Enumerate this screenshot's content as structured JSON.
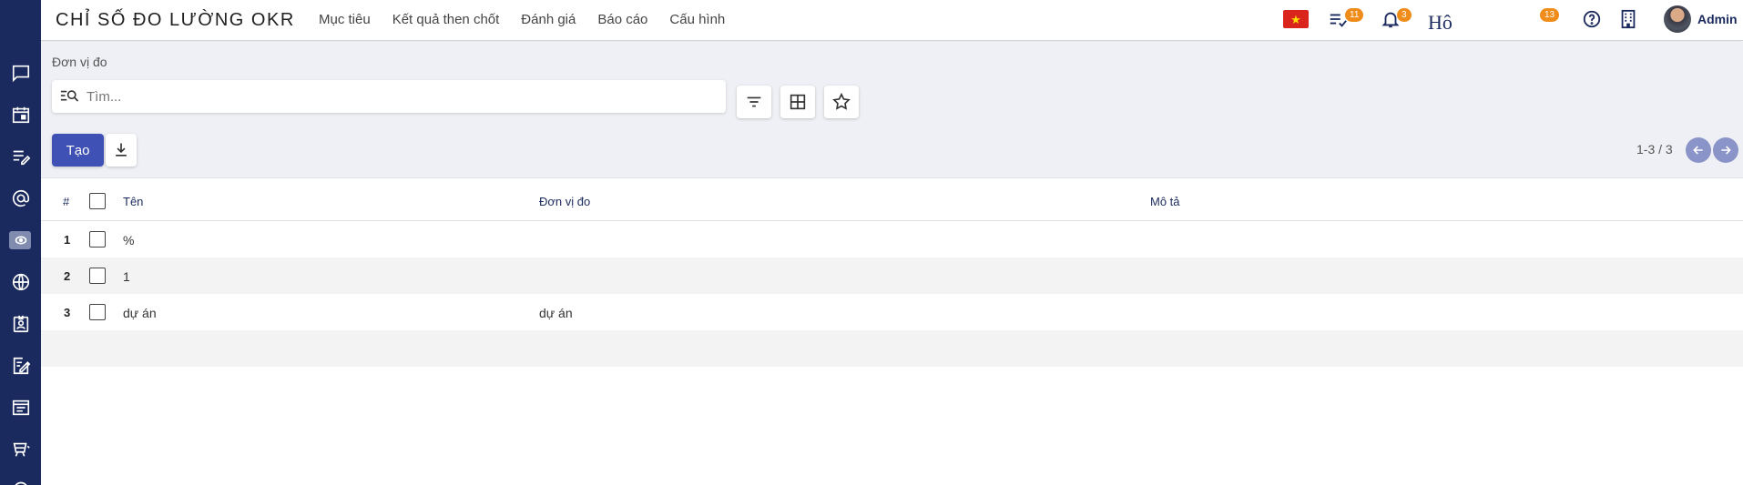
{
  "header": {
    "app_title": "CHỈ SỐ ĐO LƯỜNG OKR",
    "menu": [
      "Mục tiêu",
      "Kết quả then chốt",
      "Đánh giá",
      "Báo cáo",
      "Cấu hình"
    ],
    "flag_star": "★",
    "activity_badge": "11",
    "notification_badge": "3",
    "ho_text": "Hô",
    "messages_badge": "13",
    "user_name": "Admin"
  },
  "control": {
    "breadcrumb": "Đơn vị đo",
    "search_placeholder": "Tìm...",
    "create_label": "Tạo",
    "pager_text": "1-3 / 3"
  },
  "table": {
    "headers": {
      "index": "#",
      "name": "Tên",
      "unit": "Đơn vị đo",
      "description": "Mô tả"
    },
    "rows": [
      {
        "index": "1",
        "name": "%",
        "unit": "",
        "description": ""
      },
      {
        "index": "2",
        "name": "1",
        "unit": "",
        "description": ""
      },
      {
        "index": "3",
        "name": "dự án",
        "unit": "dự án",
        "description": ""
      }
    ]
  },
  "colors": {
    "sidebar": "#1b2a5e",
    "primary_button": "#3f51b5",
    "badge": "#f08c1a",
    "pager_button": "#8a94c8"
  },
  "icons": {
    "sidebar": [
      "chat-icon",
      "calendar-icon",
      "edit-list-icon",
      "at-icon",
      "okr-icon",
      "globe-icon",
      "contact-icon",
      "note-edit-icon",
      "article-icon",
      "board-icon"
    ],
    "toolbar": [
      "filter-icon",
      "group-by-icon",
      "favorite-icon"
    ]
  }
}
